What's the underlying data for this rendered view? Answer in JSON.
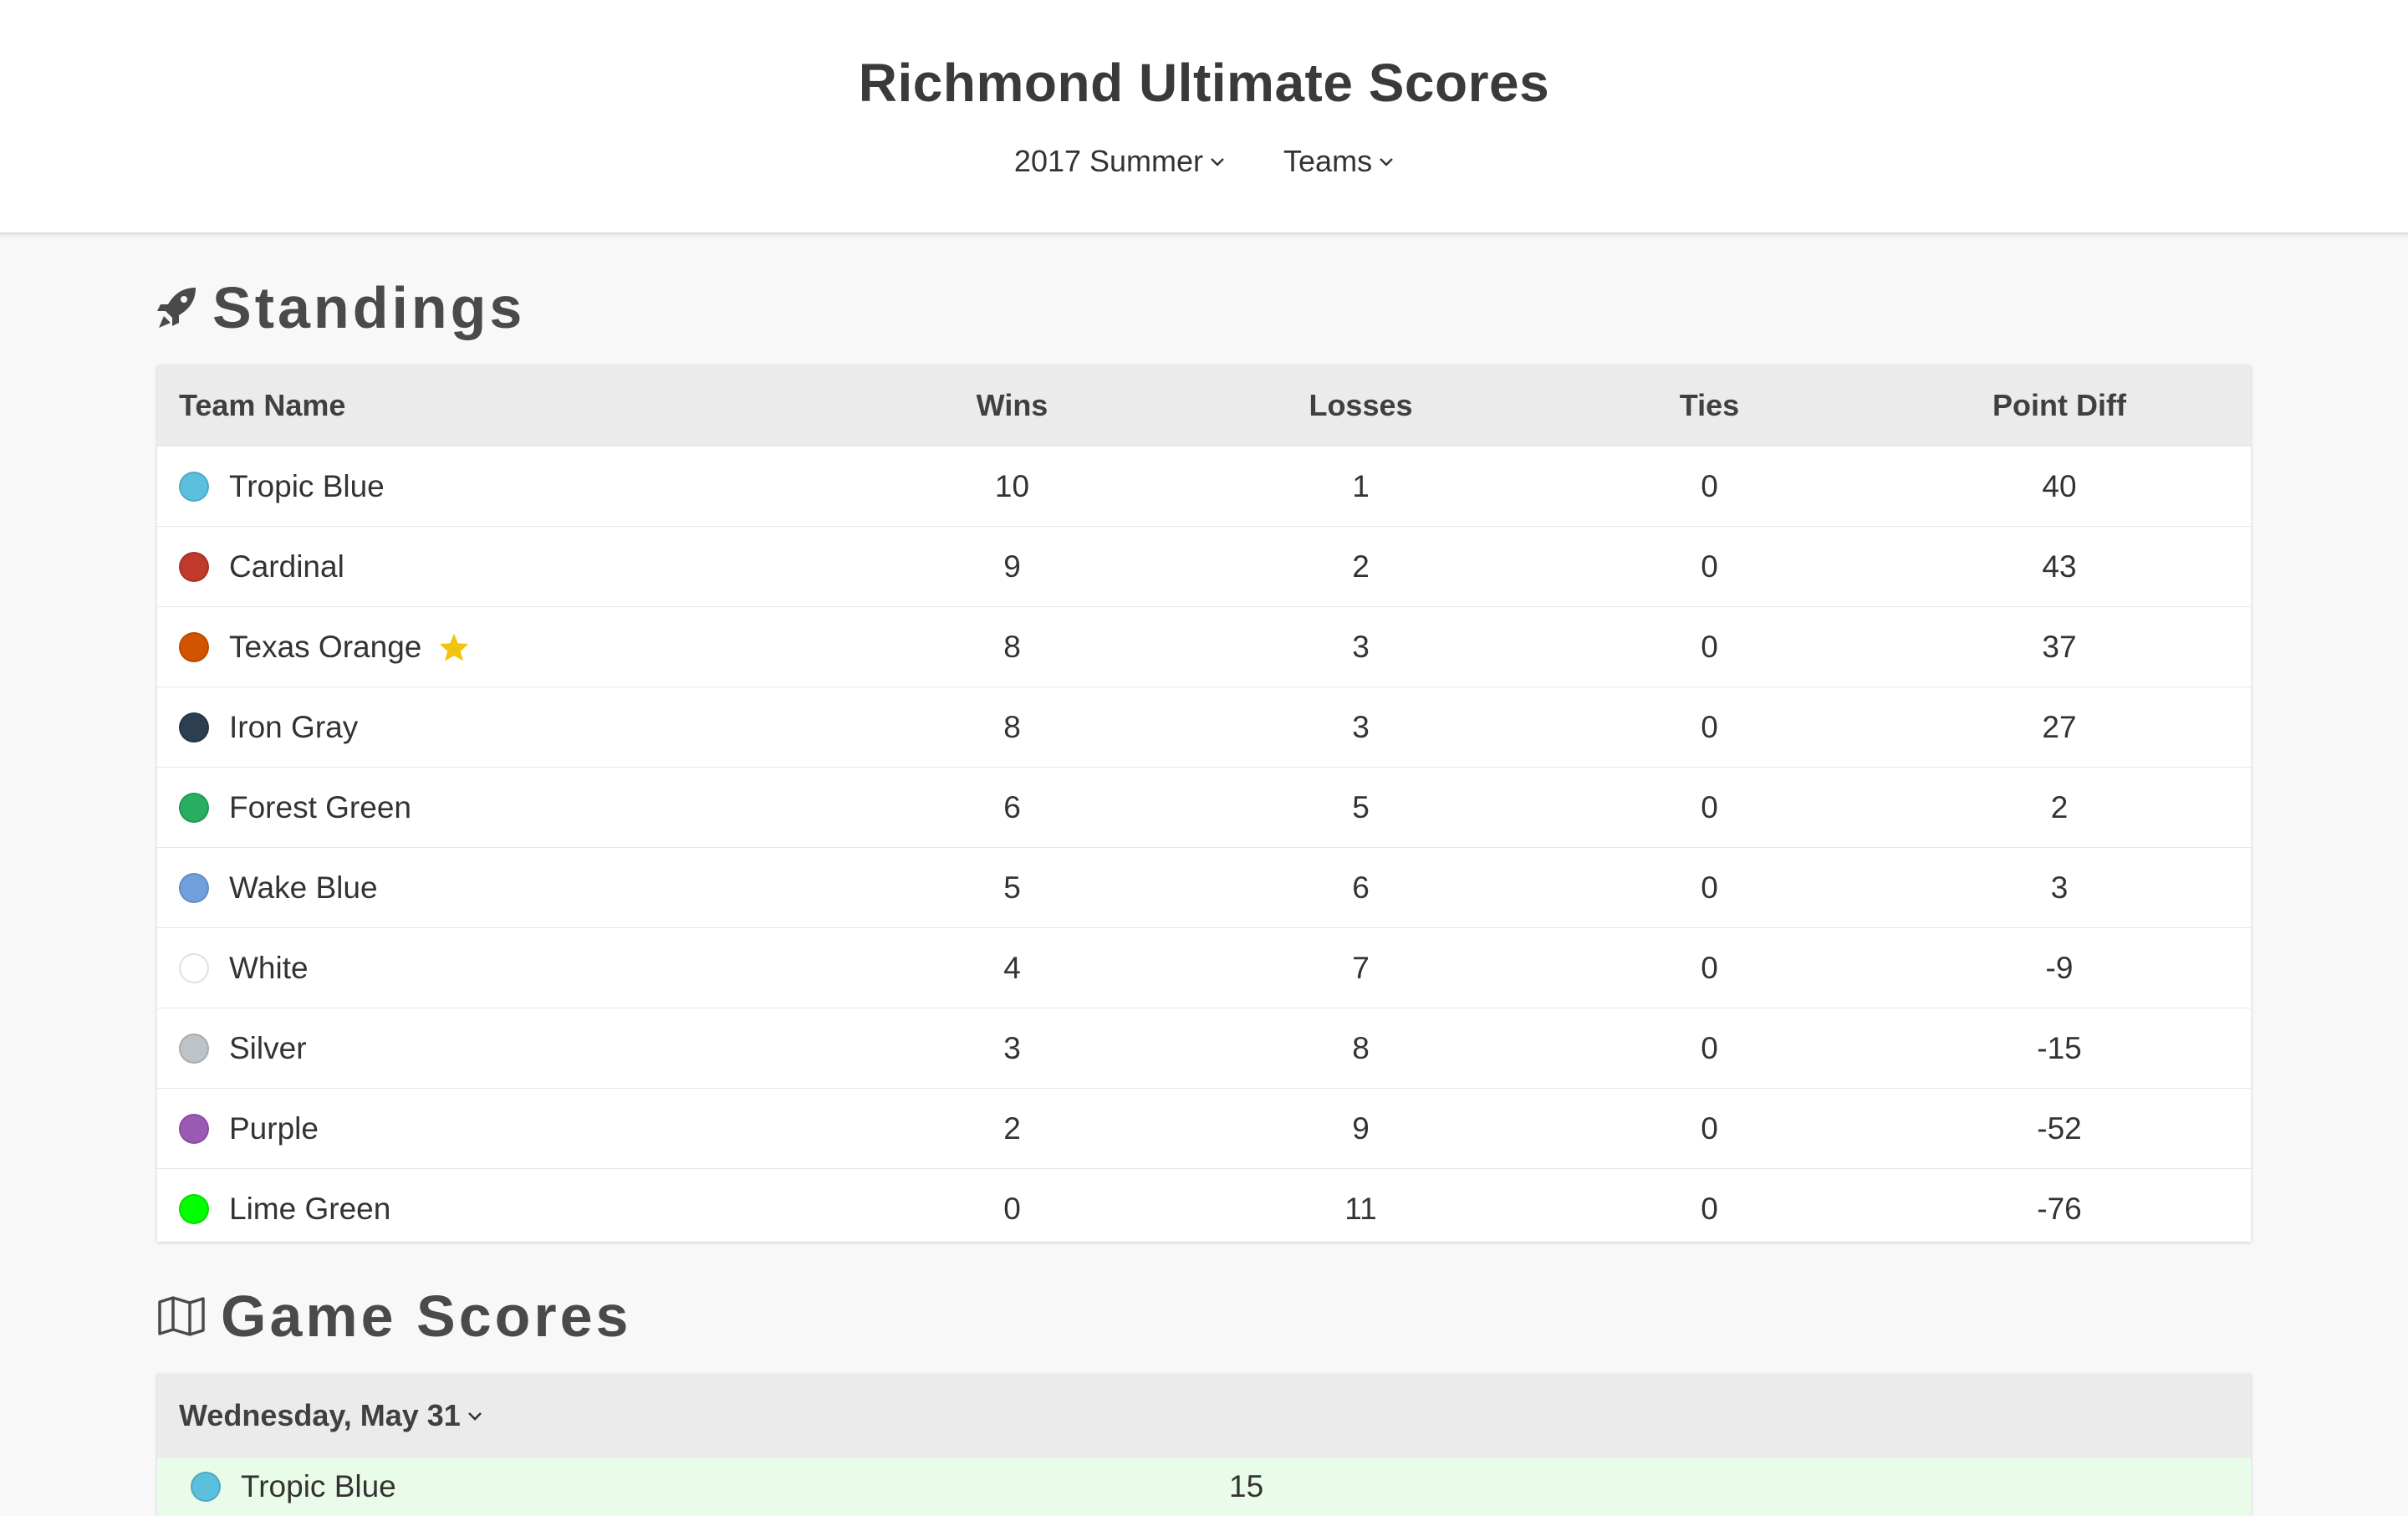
{
  "header": {
    "title": "Richmond Ultimate Scores",
    "season_label": "2017 Summer",
    "teams_label": "Teams"
  },
  "standings": {
    "heading": "Standings",
    "icon": "rocket-icon",
    "columns": [
      "Team Name",
      "Wins",
      "Losses",
      "Ties",
      "Point Diff"
    ],
    "rows": [
      {
        "team": "Tropic Blue",
        "color": "#5bc0de",
        "wins": "10",
        "losses": "1",
        "ties": "0",
        "diff": "40",
        "star": false
      },
      {
        "team": "Cardinal",
        "color": "#c0392b",
        "wins": "9",
        "losses": "2",
        "ties": "0",
        "diff": "43",
        "star": false
      },
      {
        "team": "Texas Orange",
        "color": "#d35400",
        "wins": "8",
        "losses": "3",
        "ties": "0",
        "diff": "37",
        "star": true
      },
      {
        "team": "Iron Gray",
        "color": "#2c3e50",
        "wins": "8",
        "losses": "3",
        "ties": "0",
        "diff": "27",
        "star": false
      },
      {
        "team": "Forest Green",
        "color": "#27ae60",
        "wins": "6",
        "losses": "5",
        "ties": "0",
        "diff": "2",
        "star": false
      },
      {
        "team": "Wake Blue",
        "color": "#6fa0dc",
        "wins": "5",
        "losses": "6",
        "ties": "0",
        "diff": "3",
        "star": false
      },
      {
        "team": "White",
        "color": "#ffffff",
        "wins": "4",
        "losses": "7",
        "ties": "0",
        "diff": "-9",
        "star": false
      },
      {
        "team": "Silver",
        "color": "#bdc3c7",
        "wins": "3",
        "losses": "8",
        "ties": "0",
        "diff": "-15",
        "star": false
      },
      {
        "team": "Purple",
        "color": "#9b59b6",
        "wins": "2",
        "losses": "9",
        "ties": "0",
        "diff": "-52",
        "star": false
      },
      {
        "team": "Lime Green",
        "color": "#00ff00",
        "wins": "0",
        "losses": "11",
        "ties": "0",
        "diff": "-76",
        "star": false
      }
    ]
  },
  "game_scores": {
    "heading": "Game Scores",
    "icon": "map-icon",
    "date_label": "Wednesday, May 31",
    "games": [
      {
        "team": "Tropic Blue",
        "color": "#5bc0de",
        "score": "15"
      }
    ]
  },
  "colors": {
    "star": "#f1c40f",
    "header_bg": "#ffffff",
    "page_bg": "#f8f8f8",
    "table_head_bg": "#ebebeb",
    "win_row_bg": "#e9fbe9"
  }
}
